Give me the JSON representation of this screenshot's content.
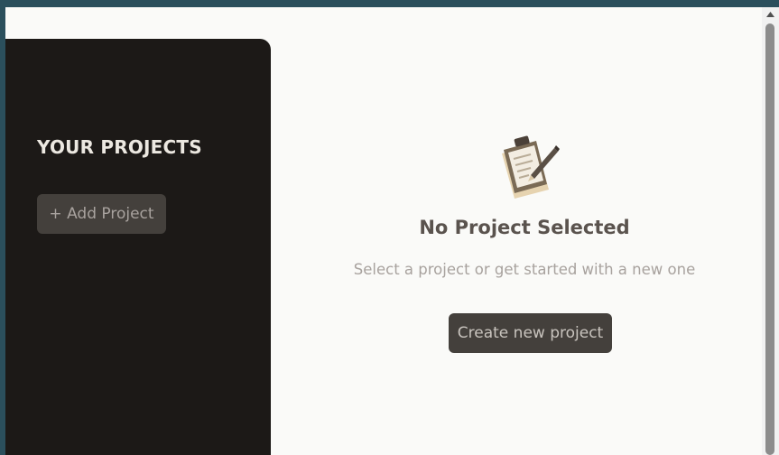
{
  "sidebar": {
    "title": "YOUR PROJECTS",
    "add_button_label": "+ Add Project"
  },
  "main": {
    "empty_state_icon": "clipboard-icon",
    "heading": "No Project Selected",
    "subtitle": "Select a project or get started with a new one",
    "create_button_label": "Create new project"
  },
  "colors": {
    "sidebar_bg": "#1c1917",
    "button_bg": "#44403c",
    "page_bg": "#fafaf8",
    "frame": "#2b4f5c"
  }
}
